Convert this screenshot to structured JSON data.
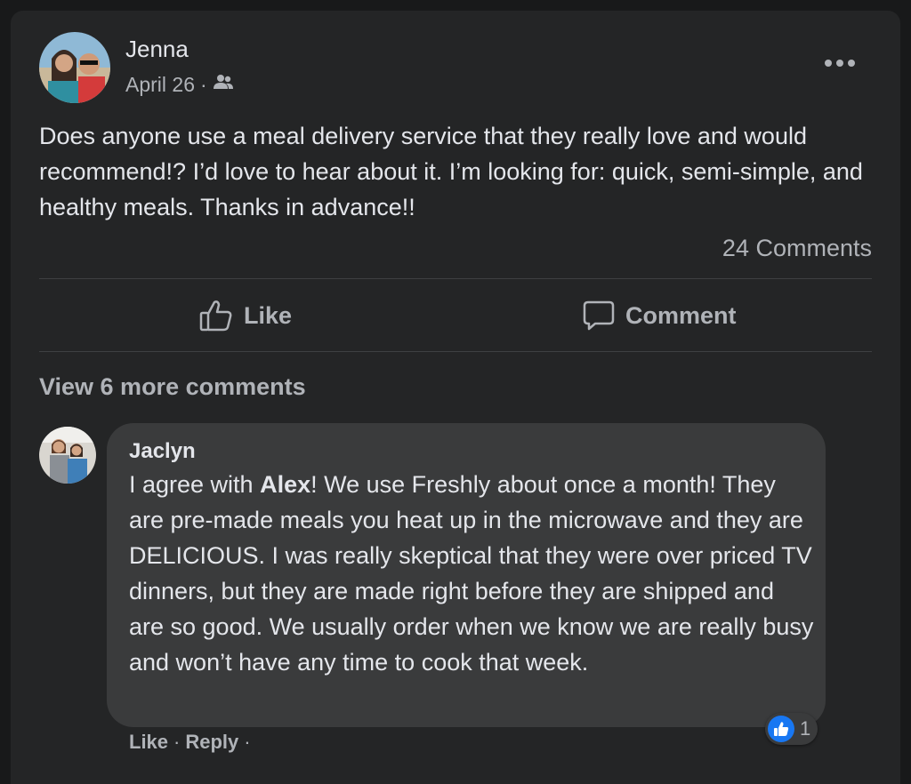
{
  "post": {
    "author": "Jenna",
    "date": "April 26",
    "separator": "·",
    "audience_icon": "group-icon",
    "text": "Does anyone use a meal delivery service that they really love and would recommend!? I’d love to hear about it. I’m looking for: quick, semi-simple, and healthy meals. Thanks in advance!!",
    "comments_count": "24 Comments"
  },
  "actions": {
    "like_label": "Like",
    "comment_label": "Comment"
  },
  "view_more": "View 6 more comments",
  "comment": {
    "author": "Jaclyn",
    "text_before": "I agree with ",
    "mention": "Alex",
    "text_after": "! We use Freshly about once a month! They are pre-made meals you heat up in the microwave and they are DELICIOUS. I was really skeptical that they were over priced TV dinners, but they are made right before they are shipped and are so good. We usually order when we know we are really busy and won’t have any time to cook that week.",
    "reaction_count": "1",
    "like_label": "Like",
    "reply_label": "Reply",
    "separator": "·"
  },
  "colors": {
    "background": "#18191a",
    "card": "#242526",
    "bubble": "#3a3b3c",
    "text_primary": "#e4e6eb",
    "text_secondary": "#b0b3b8",
    "like_blue": "#1877f2"
  }
}
